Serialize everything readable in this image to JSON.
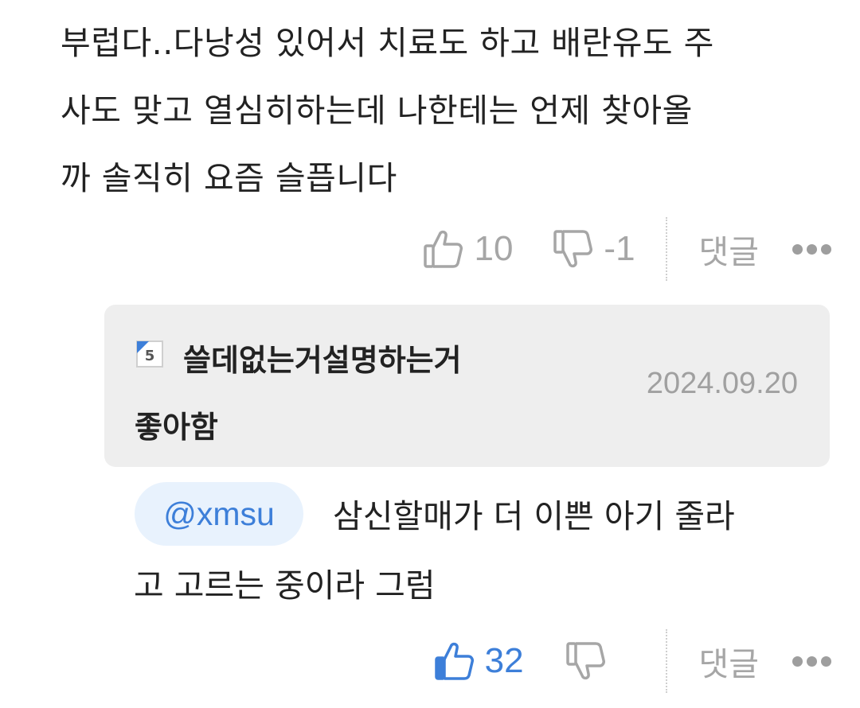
{
  "comment": {
    "line1": "부럽다..다낭성 있어서 치료도 하고 배란유도 주",
    "line2": "사도 맞고 열심히하는데 나한테는 언제 찾아올",
    "line3": "까 솔직히 요즘 슬픕니다",
    "likes": "10",
    "dislikes": "-1",
    "reply_label": "댓글",
    "like_icon": "thumbs-up-outline-icon",
    "dislike_icon": "thumbs-down-outline-icon",
    "more_icon": "more-dots-icon"
  },
  "quoted": {
    "line1": "쓸데없는거설명하는거",
    "line2": "좋아함",
    "date": "2024.09.20",
    "icon": "level-badge-icon"
  },
  "reply": {
    "mention": "@xmsu",
    "text_line1": "삼신할매가 더 이쁜 아기 줄라",
    "text_line2": "고 고르는 중이라 그럼",
    "likes": "32",
    "reply_label": "댓글",
    "like_icon": "thumbs-up-filled-icon",
    "dislike_icon": "thumbs-down-outline-icon",
    "more_icon": "more-dots-icon"
  },
  "colors": {
    "accent_blue": "#3d7fd9",
    "muted_gray": "#a6a6a6",
    "quote_bg": "#eeeeee",
    "mention_bg": "#e8f2fd"
  }
}
